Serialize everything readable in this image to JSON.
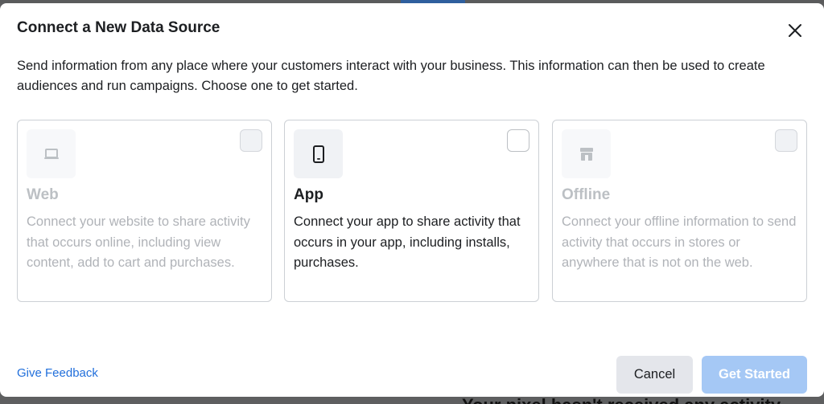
{
  "dialog": {
    "title": "Connect a New Data Source",
    "description": "Send information from any place where your customers interact with your business. This information can then be used to create audiences and run campaigns. Choose one to get started."
  },
  "cards": [
    {
      "icon": "laptop-icon",
      "title": "Web",
      "description": "Connect your website to share activity that occurs online, including view content, add to cart and purchases.",
      "state": "disabled"
    },
    {
      "icon": "phone-icon",
      "title": "App",
      "description": "Connect your app to share activity that occurs in your app, including installs, purchases.",
      "state": "enabled"
    },
    {
      "icon": "store-icon",
      "title": "Offline",
      "description": "Connect your offline information to send activity that occurs in stores or anywhere that is not on the web.",
      "state": "disabled"
    }
  ],
  "footer": {
    "feedback_label": "Give Feedback",
    "cancel_label": "Cancel",
    "start_label": "Get Started"
  },
  "backdrop": {
    "partial_text": "Your pixel hasn't received any activity."
  },
  "colors": {
    "link": "#216fdb",
    "primary_disabled": "#a5c8f5",
    "secondary_button": "#e4e6eb",
    "text": "#1c1e21",
    "muted_text": "#b0b3b8"
  }
}
